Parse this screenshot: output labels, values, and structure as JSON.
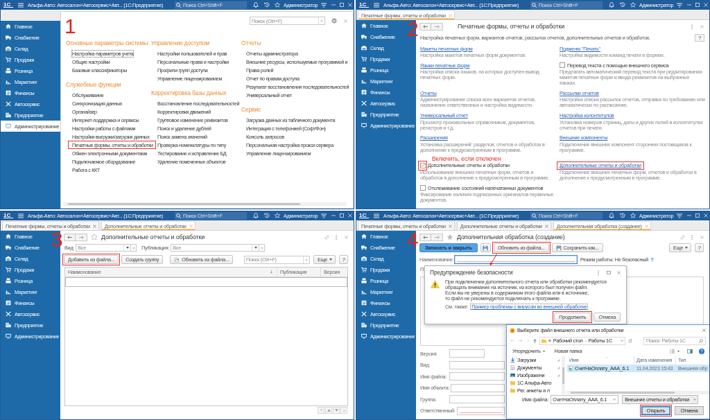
{
  "panels": [
    {
      "step": "1",
      "titlebar": {
        "logo": "1С",
        "title": "Альфа-Авто: Автосалон+Автосервис+Авт... (1С:Предприятие)",
        "search_placeholder": "Поиск Ctrl+Shift+F",
        "user": "Администратор"
      },
      "sidebar": [
        {
          "label": "Главное",
          "selected": false
        },
        {
          "label": "Снабжение",
          "selected": false
        },
        {
          "label": "Склад",
          "selected": false
        },
        {
          "label": "Продажи",
          "selected": false
        },
        {
          "label": "Розница",
          "selected": false
        },
        {
          "label": "Маркетинг",
          "selected": false
        },
        {
          "label": "Финансы",
          "selected": false
        },
        {
          "label": "Автосервис",
          "selected": false
        },
        {
          "label": "Предприятие",
          "selected": false
        },
        {
          "label": "Администрирование",
          "selected": true
        }
      ],
      "content": {
        "kind": "sections",
        "search_placeholder": "Поиск (Ctrl+F)",
        "columns": [
          {
            "groups": [
              {
                "heading": "Основные параметры системы",
                "items": [
                  {
                    "label": "Настройка параметров учета",
                    "focused": true,
                    "highlighted": false
                  },
                  {
                    "label": "Общие настройки",
                    "focused": false,
                    "highlighted": false
                  },
                  {
                    "label": "Базовые классификаторы",
                    "focused": false,
                    "highlighted": false
                  }
                ]
              },
              {
                "heading": "Служебные функции",
                "items": [
                  {
                    "label": "Обслуживание",
                    "focused": false,
                    "highlighted": false
                  },
                  {
                    "label": "Синхронизация данных",
                    "focused": false,
                    "highlighted": false
                  },
                  {
                    "label": "Органайзер",
                    "focused": false,
                    "highlighted": false
                  },
                  {
                    "label": "Интернет-поддержка и сервисы",
                    "focused": false,
                    "highlighted": false
                  },
                  {
                    "label": "Настройки работы с файлами",
                    "focused": false,
                    "highlighted": false
                  },
                  {
                    "label": "Настройки выгрузки/загрузки данных",
                    "focused": false,
                    "highlighted": false
                  },
                  {
                    "label": "Печатные формы, отчеты и обработки",
                    "focused": false,
                    "highlighted": true
                  },
                  {
                    "label": "Обмен электронными документами",
                    "focused": false,
                    "highlighted": false
                  },
                  {
                    "label": "Подключаемое оборудование",
                    "focused": false,
                    "highlighted": false
                  },
                  {
                    "label": "Работа с ККТ",
                    "focused": false,
                    "highlighted": false
                  }
                ]
              }
            ]
          },
          {
            "groups": [
              {
                "heading": "Управление доступом",
                "items": [
                  {
                    "label": "Настройки пользователей и прав",
                    "focused": false,
                    "highlighted": false
                  },
                  {
                    "label": "Персональные права и настройки",
                    "focused": false,
                    "highlighted": false
                  },
                  {
                    "label": "Профили групп доступа",
                    "focused": false,
                    "highlighted": false
                  },
                  {
                    "label": "Управление лицензированием",
                    "focused": false,
                    "highlighted": false
                  }
                ]
              },
              {
                "heading": "Корректировка базы данных",
                "items": [
                  {
                    "label": "Восстановление последовательностей",
                    "focused": false,
                    "highlighted": false
                  },
                  {
                    "label": "Корректировки движений",
                    "focused": false,
                    "highlighted": false
                  },
                  {
                    "label": "Групповое изменение реквизитов",
                    "focused": false,
                    "highlighted": false
                  },
                  {
                    "label": "Поиск и удаление дублей",
                    "focused": false,
                    "highlighted": false
                  },
                  {
                    "label": "Поиск замена значений",
                    "focused": false,
                    "highlighted": false
                  },
                  {
                    "label": "Проверка номенклатуры по типу",
                    "focused": false,
                    "highlighted": false
                  },
                  {
                    "label": "Тестирование и исправление БД",
                    "focused": false,
                    "highlighted": false
                  },
                  {
                    "label": "Удаление помеченных объектов",
                    "focused": false,
                    "highlighted": false
                  }
                ]
              }
            ]
          },
          {
            "groups": [
              {
                "heading": "Отчеты",
                "items": [
                  {
                    "label": "Отчеты администратора",
                    "focused": false,
                    "highlighted": false
                  },
                  {
                    "label": "Внешние ресурсы, используемые программой и",
                    "focused": false,
                    "highlighted": false
                  },
                  {
                    "label": "Права ролей",
                    "focused": false,
                    "highlighted": false
                  },
                  {
                    "label": "Отчет по правам доступа",
                    "focused": false,
                    "highlighted": false
                  },
                  {
                    "label": "Результат восстановления последовательностей",
                    "focused": false,
                    "highlighted": false
                  },
                  {
                    "label": "Универсальный отчет",
                    "focused": false,
                    "highlighted": false
                  }
                ]
              },
              {
                "heading": "Сервис",
                "items": [
                  {
                    "label": "Загрузка данных из табличного документа",
                    "focused": false,
                    "highlighted": false
                  },
                  {
                    "label": "Интеграция с телефонией (СофтФон)",
                    "focused": false,
                    "highlighted": false
                  },
                  {
                    "label": "Консоль запросов",
                    "focused": false,
                    "highlighted": false
                  },
                  {
                    "label": "Персональная настройка прокси сервера",
                    "focused": false,
                    "highlighted": false
                  },
                  {
                    "label": "Управление лицензированием",
                    "focused": false,
                    "highlighted": false
                  }
                ]
              }
            ]
          }
        ]
      }
    },
    {
      "step": "2",
      "titlebar": {
        "logo": "1С",
        "title": "Альфа-Авто: Автосалон+Автосервис+Авт... (1С:Предприятие)",
        "search_placeholder": "Поиск Ctrl+Shift+F",
        "user": "Администратор"
      },
      "tabs": [
        {
          "label": "Печатные формы, отчеты и обработки",
          "selected": true
        }
      ],
      "sidebar": [
        {
          "label": "Главное",
          "selected": false
        },
        {
          "label": "Снабжение",
          "selected": false
        },
        {
          "label": "Склад",
          "selected": false
        },
        {
          "label": "Продажи",
          "selected": false
        },
        {
          "label": "Розница",
          "selected": false
        },
        {
          "label": "Маркетинг",
          "selected": false
        },
        {
          "label": "Финансы",
          "selected": false
        },
        {
          "label": "Автосервис",
          "selected": false
        },
        {
          "label": "Предприятие",
          "selected": false
        },
        {
          "label": "Администрирование",
          "selected": false
        }
      ],
      "content": {
        "kind": "settings",
        "header": {
          "title": "Печатные формы, отчеты и обработки"
        },
        "description": "Настройка печатных форм, вариантов отчетов, рассылок отчетов, дополнительных отчетов и обработок.",
        "help": "?",
        "rows": [
          {
            "items": [
              {
                "kind": "link",
                "label": "Макеты печатных форм",
                "description": "Настройка макетов печатных форм документов.",
                "highlighted": false
              },
              {
                "kind": "link",
                "label": "Подменю \"Печать\"",
                "description": "Настройка видимости команд печати в формах.",
                "highlighted": false
              }
            ]
          },
          {
            "items": [
              {
                "kind": "link",
                "label": "Языки печатных форм",
                "description": "Настройка списка языков, на которых доступен вывод печатных форм.",
                "highlighted": false
              },
              {
                "kind": "checkbox",
                "label": "Перевод текста с помощью внешнего сервиса",
                "checked": false,
                "highlighted": false,
                "description": "Предлагать автоматический перевод текста при редактировании макетов печатных форм и ввода реквизитов на выбранных языках."
              }
            ]
          },
          {
            "items": [
              {
                "kind": "link",
                "label": "Отчеты",
                "description": "Администрирование списка всех вариантов отчетов, назначение ответственных и настройка видимости.",
                "highlighted": false
              },
              {
                "kind": "link",
                "label": "Рассылки отчетов",
                "description": "Настройка списка рассылок отчетов, отправка по требованию или автоматически по расписанию.",
                "highlighted": false
              }
            ]
          },
          {
            "items": [
              {
                "kind": "link",
                "label": "Универсальный отчет",
                "description": "Просмотр произвольных справочников, документов, регистров и т.д.",
                "highlighted": false
              },
              {
                "kind": "link",
                "label": "Настройка колонтитулов",
                "description": "Установка номеров страниц, даты и других полей в колонтитулах отчетов при печати.",
                "highlighted": false
              }
            ]
          },
          {
            "items": [
              {
                "kind": "link",
                "label": "Расширения",
                "description": "Установка расширений: разделов, отчетов и обработок в дополнение к предусмотренным в программе.",
                "highlighted": false
              },
              {
                "kind": "link",
                "label": "Внешние компоненты",
                "description": "Подключение внешних компонент сторонних поставщиков к программе.",
                "highlighted": false
              }
            ]
          },
          {
            "items": [
              {
                "kind": "checkbox",
                "label": "Дополнительные отчеты и обработки",
                "checked": true,
                "highlighted": true,
                "note": "Включить, если отключен",
                "description": "Использование внешних печатных форм, отчетов и обработок в дополнение к предусмотренным в программе."
              },
              {
                "kind": "link",
                "label": "Дополнительные отчеты и обработки",
                "description": "Подключение внешних печатных форм, отчетов и обработок в дополнение к предусмотренным в программе.",
                "highlighted": true
              }
            ]
          },
          {
            "items": [
              {
                "kind": "checkbox",
                "label": "Отслеживание состояний напечатанных документов",
                "checked": false,
                "highlighted": false,
                "description": "Фиксирование наличия подписанных оригиналов первичных документов."
              }
            ]
          }
        ]
      }
    },
    {
      "step": "3",
      "titlebar": {
        "logo": "1С",
        "title": "Альфа-Авто: Автосалон+Автосервис+Авт... (1С:Предприятие)",
        "search_placeholder": "Поиск Ctrl+Shift+F",
        "user": "Администратор"
      },
      "tabs": [
        {
          "label": "Печатные формы, отчеты и обработки",
          "selected": false
        },
        {
          "label": "Дополнительные отчеты и обработки",
          "selected": true
        }
      ],
      "sidebar": [
        {
          "label": "Главное",
          "selected": false
        },
        {
          "label": "Снабжение",
          "selected": false
        },
        {
          "label": "Склад",
          "selected": false
        },
        {
          "label": "Продажи",
          "selected": false
        },
        {
          "label": "Розница",
          "selected": false
        },
        {
          "label": "Маркетинг",
          "selected": false
        },
        {
          "label": "Финансы",
          "selected": false
        },
        {
          "label": "Автосервис",
          "selected": false
        },
        {
          "label": "Предприятие",
          "selected": false
        },
        {
          "label": "Администрирование",
          "selected": false
        }
      ],
      "content": {
        "kind": "list",
        "header": {
          "title": "Дополнительные отчеты и обработки",
          "favorite": false,
          "link_icon": true
        },
        "filters": [
          {
            "label": "Вид:",
            "placeholder": "Все"
          },
          {
            "label": "Публикация:",
            "placeholder": "Все"
          }
        ],
        "toolbar": [
          {
            "kind": "plain",
            "label": "Добавить из файла...",
            "highlighted": true
          },
          {
            "kind": "plain",
            "label": "Создать группу",
            "highlighted": false
          },
          {
            "kind": "with-icon",
            "label": "Обновить из файла...",
            "highlighted": false
          }
        ],
        "search_placeholder": "Поиск (Ctrl+F)",
        "more": "Еще",
        "help": "?",
        "table": {
          "columns": [
            {
              "label": "Наименование",
              "sorted": true
            },
            {
              "label": "Публикация",
              "sorted": false
            },
            {
              "label": "Версия",
              "sorted": false
            }
          ]
        }
      }
    },
    {
      "step": "4",
      "titlebar": {
        "logo": "1С",
        "title": "Альфа-Авто: Автосалон+Автосервис+Авт... (1С:Предприятие)",
        "search_placeholder": "Поиск Ctrl+Shift+F",
        "user": "Администратор"
      },
      "tabs": [
        {
          "label": "Печатные формы, отчеты и обработки",
          "selected": false
        },
        {
          "label": "Дополнительные отчеты и обработки",
          "selected": false
        },
        {
          "label": "Дополнительная обработка (создание)",
          "selected": true
        }
      ],
      "sidebar": [
        {
          "label": "Главное",
          "selected": false
        },
        {
          "label": "Снабжение",
          "selected": false
        },
        {
          "label": "Склад",
          "selected": false
        },
        {
          "label": "Продажи",
          "selected": false
        },
        {
          "label": "Розница",
          "selected": false
        },
        {
          "label": "Маркетинг",
          "selected": false
        },
        {
          "label": "Финансы",
          "selected": false
        },
        {
          "label": "Автосервис",
          "selected": false
        },
        {
          "label": "Предприятие",
          "selected": false
        },
        {
          "label": "Администрирование",
          "selected": false
        }
      ],
      "content": {
        "kind": "form",
        "header": {
          "title": "Дополнительная обработка (создание)",
          "favorite": true,
          "link_icon": true
        },
        "toolbar": [
          {
            "kind": "primary",
            "label": "Записать и закрыть",
            "highlighted": false
          },
          {
            "kind": "icon",
            "highlighted": false
          },
          {
            "kind": "plain",
            "label": "Обновить из файла...",
            "highlighted": true
          },
          {
            "kind": "with-icon",
            "label": "Сохранить как...",
            "highlighted": false
          }
        ],
        "more": "Еще",
        "help": "?",
        "name_field": {
          "label": "Наименование:",
          "required": true,
          "focused": true
        },
        "mode": "Режим работы: Не безопасный",
        "mode_help": "?",
        "covered_label": "П",
        "fields": [
          {
            "label": "Версия:",
            "kind": "short",
            "required": false
          },
          {
            "label": "Вид:",
            "kind": "wide",
            "required": false
          },
          {
            "label": "Имя файла:",
            "kind": "wide",
            "required": false
          },
          {
            "label": "Имя объекта:",
            "kind": "wide",
            "required": false
          },
          {
            "label": "Группа:",
            "kind": "wide",
            "required": false
          },
          {
            "label": "Ответственный:",
            "kind": "wide",
            "required": true
          }
        ],
        "security_dialog": {
          "title": "Предупреждение безопасности",
          "message": "При подключении дополнительного отчета или обработки рекомендуется\nобращать внимание на источник, из которого был получен файл.\nЕсли вы не уверены в содержимом этого файла или в источнике,\nто файл не рекомендуется подключать к программе.",
          "see_also": "См. также:",
          "link": "Пример проблемы с вирусом во внешней обработке",
          "buttons": [
            {
              "label": "Продолжить",
              "highlighted": true
            },
            {
              "label": "Отмена",
              "highlighted": false
            }
          ]
        },
        "file_dialog": {
          "title": "Выберите файл внешнего отчета или обработки",
          "path_overflow": "«",
          "path": [
            "Рабочий стол",
            "Работы 1С"
          ],
          "search_placeholder": "Поиск: Работы 1С",
          "toolbar": [
            {
              "kind": "menu",
              "label": "Упорядочить"
            },
            {
              "kind": "button",
              "label": "Новая папка"
            }
          ],
          "places": [
            {
              "label": "Загрузки",
              "pinned": true
            },
            {
              "label": "Документы",
              "pinned": true
            },
            {
              "label": "Изображени",
              "pinned": true
            },
            {
              "label": "1С Альфа-Авто",
              "pinned": false
            },
            {
              "label": "Рег. анкеты и л",
              "pinned": false
            }
          ],
          "columns": [
            {
              "label": "Имя",
              "sorted": true
            },
            {
              "label": "Дата изменения",
              "sorted": false
            },
            {
              "label": "Тип",
              "sorted": false
            }
          ],
          "files": [
            {
              "name": "СчетНаОплату_ААА_6.1",
              "modified": "11.04.2023 15:43",
              "type": "Внешняя обр",
              "selected": true
            }
          ],
          "file_name_label": "Имя файла:",
          "file_name": "СчетНаОплату_ААА_6.1",
          "filter": "Внешние отчеты и обработки",
          "buttons": [
            {
              "label": "Открыть",
              "highlighted": true,
              "default": true
            },
            {
              "label": "Отмена",
              "highlighted": false,
              "default": false
            }
          ]
        }
      }
    }
  ]
}
